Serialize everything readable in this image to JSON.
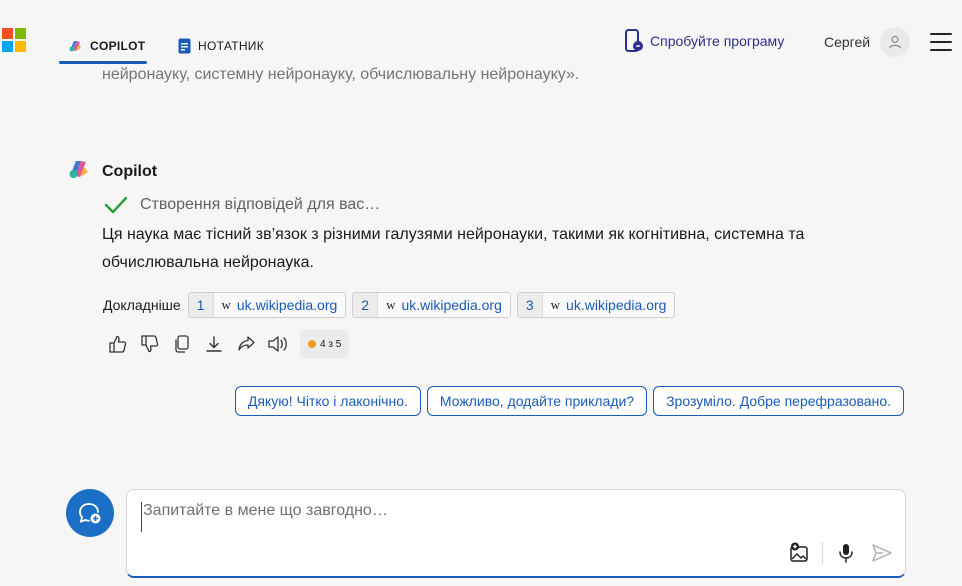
{
  "header": {
    "tabs": [
      {
        "label": "COPILOT",
        "active": true
      },
      {
        "label": "НОТАТНИК",
        "active": false
      }
    ],
    "try_app_label": "Спробуйте програму",
    "user_name": "Сергей",
    "logo_colors": [
      "#f25022",
      "#7fba00",
      "#00a4ef",
      "#ffb900"
    ]
  },
  "conversation": {
    "previous_text": "нейронауку, системну нейронауку, обчислювальну нейронауку».",
    "copilot_name": "Copilot",
    "status_text": "Створення відповідей для вас…",
    "answer_text": "Ця наука має тісний зв’язок з різними галузями нейронауки, такими як когнітивна, системна та обчислювальна нейронаука.",
    "sources_label": "Докладніше",
    "sources": [
      {
        "num": "1",
        "icon": "w",
        "site": "uk.wikipedia.org"
      },
      {
        "num": "2",
        "icon": "w",
        "site": "uk.wikipedia.org"
      },
      {
        "num": "3",
        "icon": "w",
        "site": "uk.wikipedia.org"
      }
    ],
    "actions": [
      "thumbs-up-icon",
      "thumbs-down-icon",
      "copy-icon",
      "download-icon",
      "share-icon",
      "read-aloud-icon"
    ],
    "turn_counter": "4 з 5",
    "suggestions": [
      "Дякую! Чітко і лаконічно.",
      "Можливо, додайте приклади?",
      "Зрозуміло. Добре перефразовано."
    ]
  },
  "composer": {
    "placeholder": "Запитайте в мене що завгодно…",
    "value": ""
  },
  "colors": {
    "accent": "#1b5bb8",
    "status_check": "#2e9e3e",
    "counter_dot": "#f29c1f"
  }
}
